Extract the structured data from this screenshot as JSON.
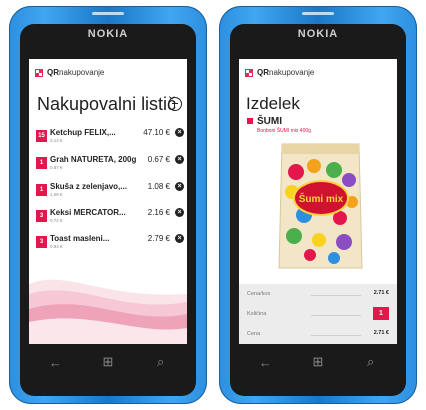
{
  "device": {
    "brand": "NOKIA"
  },
  "app": {
    "logo_bold": "QR",
    "logo_rest": "nakupovanje"
  },
  "shopping_list": {
    "title": "Nakupovalni listič",
    "items": [
      {
        "qty": "15",
        "name": "Ketchup FELIX,...",
        "unit_price": "3.14 €",
        "total": "47.10 €"
      },
      {
        "qty": "1",
        "name": "Grah NATURETA, 200g",
        "unit_price": "0.67 €",
        "total": "0.67 €"
      },
      {
        "qty": "1",
        "name": "Skuša z zelenjavo,...",
        "unit_price": "1.08 €",
        "total": "1.08 €"
      },
      {
        "qty": "3",
        "name": "Keksi MERCATOR...",
        "unit_price": "0.72 €",
        "total": "2.16 €"
      },
      {
        "qty": "3",
        "name": "Toast masleni...",
        "unit_price": "0.93 €",
        "total": "2.79 €"
      }
    ]
  },
  "product": {
    "title": "Izdelek",
    "name": "ŠUMI",
    "subtitle": "Bonboni ŠUMI mix 400g",
    "image_label": "Šumi mix",
    "specs": {
      "unit_price_label": "Cena/kos",
      "unit_price": "2.71 €",
      "quantity_label": "Količina",
      "quantity": "1",
      "price_label": "Cena",
      "price": "2.71 €"
    }
  },
  "icons": {
    "back": "back-arrow-icon",
    "start": "windows-logo-icon",
    "search": "search-icon"
  },
  "colors": {
    "accent": "#e4174d",
    "phone_body": "#2d8fe0"
  }
}
